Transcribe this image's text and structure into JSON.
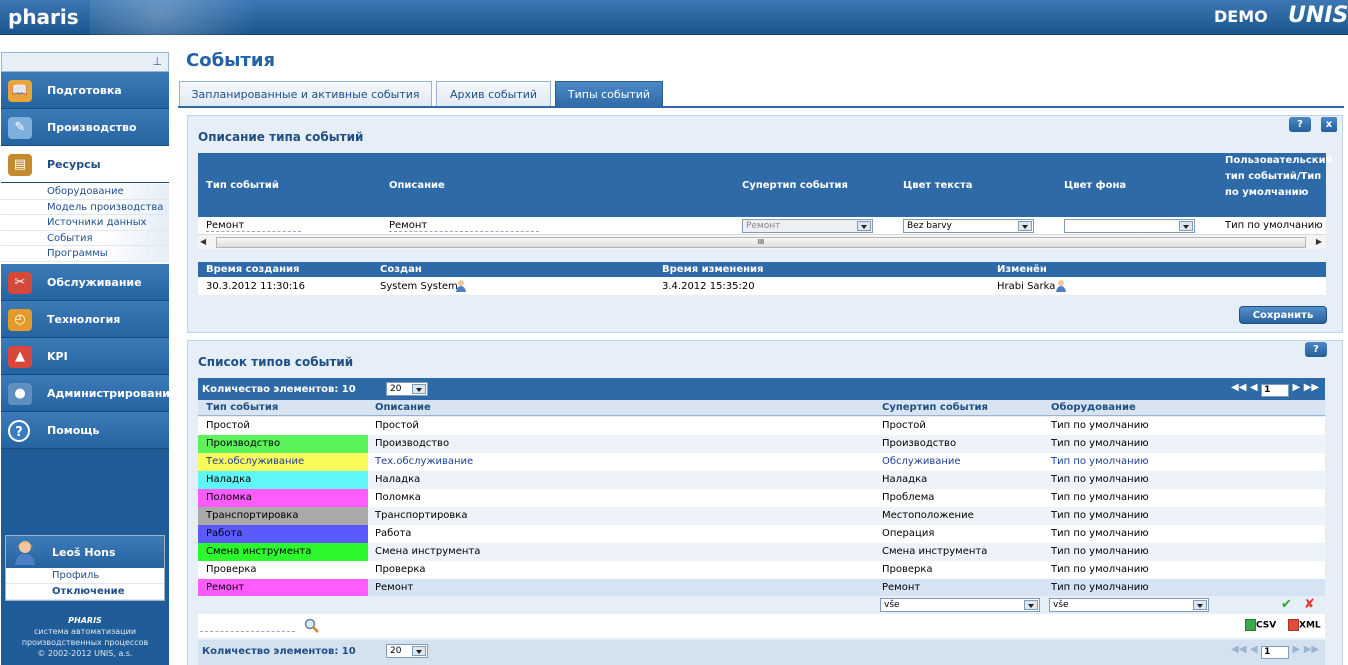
{
  "header": {
    "logo": "pharis",
    "demo": "DEMO",
    "brand": "UNIS"
  },
  "sidebar": {
    "pin": "⊥",
    "items": [
      {
        "label": "Подготовка",
        "icon": "book-icon",
        "color": "#e8a63a"
      },
      {
        "label": "Производство",
        "icon": "tools-icon",
        "color": "#7fb0dd"
      },
      {
        "label": "Ресурсы",
        "icon": "resources-icon",
        "color": "#c48a2e",
        "active": true,
        "sub": [
          "Оборудование",
          "Модель производства",
          "Источники данных",
          "События",
          "Программы"
        ]
      },
      {
        "label": "Обслуживание",
        "icon": "maintenance-icon",
        "color": "#d34a3a"
      },
      {
        "label": "Технология",
        "icon": "clock-icon",
        "color": "#e59b2c"
      },
      {
        "label": "KPI",
        "icon": "chart-icon",
        "color": "#d8473b"
      },
      {
        "label": "Администрирование",
        "icon": "users-icon",
        "color": "#5f8ec0"
      },
      {
        "label": "Помощь",
        "icon": "help-icon",
        "color": "#3a7cc0"
      }
    ],
    "user": {
      "name": "Leoš  Hons",
      "profile": "Профиль",
      "logout": "Отключение"
    },
    "footer": {
      "brand": "PHARIS",
      "line1": "система автоматизации производственных процессов",
      "copyright": "© 2002-2012 UNIS, a.s."
    }
  },
  "main": {
    "title": "События",
    "tabs": [
      "Запланированные и активные события",
      "Архив событий",
      "Типы событий"
    ],
    "detail": {
      "title": "Описание типа событий",
      "help": "?",
      "close": "x",
      "headers": [
        "Тип событий",
        "Описание",
        "Супертип события",
        "Цвет текста",
        "Цвет фона",
        "Пользовательский тип событий/Тип по умолчанию"
      ],
      "values": {
        "type": "Ремонт",
        "description": "Ремонт",
        "supertype": "Ремонт",
        "text_color": "Bez barvy",
        "bg_color": "",
        "user_type": "Тип по умолчанию"
      },
      "scroll_grip": "III",
      "meta_headers": [
        "Время создания",
        "Создан",
        "Время изменения",
        "Изменён"
      ],
      "meta_values": [
        "30.3.2012 11:30:16",
        "System System",
        "3.4.2012 15:35:20",
        "Hrabi Sarka"
      ],
      "save": "Сохранить"
    },
    "list": {
      "title": "Список типов событий",
      "help": "?",
      "count_label": "Количество элементов: 10",
      "page_size": "20",
      "page": "1",
      "columns": [
        "Тип события",
        "Описание",
        "Супертип события",
        "Оборудование"
      ],
      "rows": [
        {
          "type": "Простой",
          "desc": "Простой",
          "super": "Простой",
          "equip": "Тип по умолчанию",
          "bg": "",
          "link": false
        },
        {
          "type": "Производство",
          "desc": "Производство",
          "super": "Производство",
          "equip": "Тип по умолчанию",
          "bg": "#5cf25c",
          "link": false
        },
        {
          "type": "Тех.обслуживание",
          "desc": "Тех.обслуживание",
          "super": "Обслуживание",
          "equip": "Тип по умолчанию",
          "bg": "#fafa5a",
          "link": true
        },
        {
          "type": "Наладка",
          "desc": "Наладка",
          "super": "Наладка",
          "equip": "Тип по умолчанию",
          "bg": "#5ef7f7",
          "link": false
        },
        {
          "type": "Поломка",
          "desc": "Поломка",
          "super": "Проблема",
          "equip": "Тип по умолчанию",
          "bg": "#ff5cff",
          "link": false
        },
        {
          "type": "Транспортировка",
          "desc": "Транспортировка",
          "super": "Местоположение",
          "equip": "Тип по умолчанию",
          "bg": "#a9a9a9",
          "link": false
        },
        {
          "type": "Работа",
          "desc": "Работа",
          "super": "Операция",
          "equip": "Тип по умолчанию",
          "bg": "#5a5aff",
          "link": false
        },
        {
          "type": "Смена инструмента",
          "desc": "Смена инструмента",
          "super": "Смена инструмента",
          "equip": "Тип по умолчанию",
          "bg": "#2cf82c",
          "link": false
        },
        {
          "type": "Проверка",
          "desc": "Проверка",
          "super": "Проверка",
          "equip": "Тип по умолчанию",
          "bg": "",
          "link": false
        },
        {
          "type": "Ремонт",
          "desc": "Ремонт",
          "super": "Ремонт",
          "equip": "Тип по умолчанию",
          "bg": "#ff5cff",
          "link": false
        }
      ],
      "filter_super": "vše",
      "filter_equip": "vše",
      "export_csv": "CSV",
      "export_xml": "XML"
    }
  }
}
